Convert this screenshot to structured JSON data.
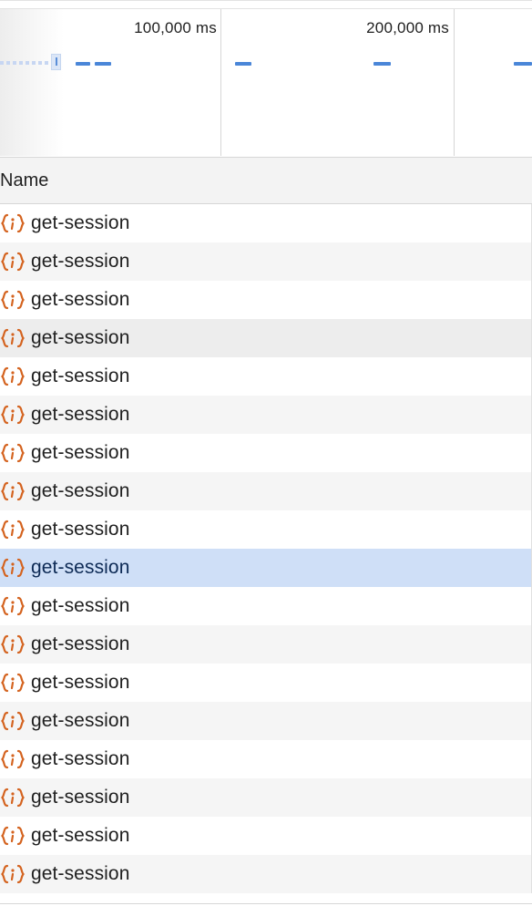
{
  "overview": {
    "ticks": [
      {
        "label": "100,000 ms"
      },
      {
        "label": "200,000 ms"
      }
    ],
    "bar_color": "#4a86d8"
  },
  "table": {
    "header": {
      "name_label": "Name"
    },
    "icon_name": "json-braces-icon",
    "icon_color": "#d4631f",
    "selected_color": "#cfdff7",
    "rows": [
      {
        "name": "get-session"
      },
      {
        "name": "get-session"
      },
      {
        "name": "get-session"
      },
      {
        "name": "get-session"
      },
      {
        "name": "get-session"
      },
      {
        "name": "get-session"
      },
      {
        "name": "get-session"
      },
      {
        "name": "get-session"
      },
      {
        "name": "get-session"
      },
      {
        "name": "get-session",
        "selected": true
      },
      {
        "name": "get-session"
      },
      {
        "name": "get-session"
      },
      {
        "name": "get-session"
      },
      {
        "name": "get-session"
      },
      {
        "name": "get-session"
      },
      {
        "name": "get-session"
      },
      {
        "name": "get-session"
      },
      {
        "name": "get-session"
      }
    ]
  }
}
